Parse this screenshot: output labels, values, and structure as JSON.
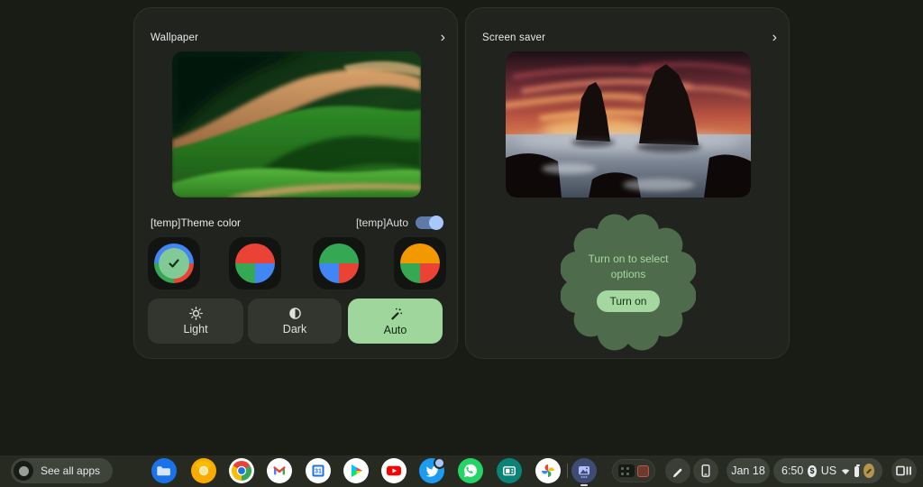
{
  "window": {
    "background": "#191b15",
    "shelf_background": "#262a21"
  },
  "wallpaper_card": {
    "title": "Wallpaper",
    "chevron": "›",
    "theme_color_label": "[temp]Theme color",
    "auto_label": "[temp]Auto",
    "auto_toggle_on": true,
    "toggle_on_color": "#a8c7fa",
    "swatches": [
      {
        "name": "color-scheme-1",
        "top": "#4285f4",
        "bottom_left": "#34a853",
        "bottom_right": "#ea4335",
        "selected": true
      },
      {
        "name": "color-scheme-2",
        "top": "#ea4335",
        "bottom_left": "#34a853",
        "bottom_right": "#4285f4",
        "selected": false
      },
      {
        "name": "color-scheme-3",
        "top": "#34a853",
        "bottom_left": "#4285f4",
        "bottom_right": "#ea4335",
        "selected": false
      },
      {
        "name": "color-scheme-4",
        "top": "#f29900",
        "bottom_left": "#34a853",
        "bottom_right": "#ea4335",
        "selected": false
      }
    ],
    "mode_buttons": [
      {
        "label": "Light",
        "icon": "sun-icon",
        "selected": false
      },
      {
        "label": "Dark",
        "icon": "half-moon-icon",
        "selected": false
      },
      {
        "label": "Auto",
        "icon": "magic-wand-icon",
        "selected": true
      }
    ],
    "selected_button_color": "#9ed69b"
  },
  "screensaver_card": {
    "title": "Screen saver",
    "chevron": "›",
    "blob_message": "Turn on to select options",
    "turn_on_label": "Turn on",
    "blob_color": "#4e6b4b",
    "blob_text_color": "#a6d8a2"
  },
  "shelf": {
    "see_all_apps_label": "See all apps",
    "apps": [
      {
        "name": "files-app-icon"
      },
      {
        "name": "chrome-canary-icon"
      },
      {
        "name": "chrome-icon"
      },
      {
        "name": "gmail-icon"
      },
      {
        "name": "calendar-icon",
        "glyph_text": "31"
      },
      {
        "name": "play-store-icon"
      },
      {
        "name": "youtube-icon"
      },
      {
        "name": "twitter-icon",
        "notification_dot": true
      },
      {
        "name": "whatsapp-icon"
      },
      {
        "name": "tv-app-icon"
      },
      {
        "name": "photos-icon"
      },
      {
        "name": "wallpaper-app-icon",
        "active": true
      },
      {
        "name": "holding-space-tote"
      },
      {
        "name": "stylus-tools-icon"
      },
      {
        "name": "phone-hub-icon"
      }
    ],
    "date": "Jan 18",
    "status": {
      "time": "6:50",
      "badge_glyph": "$",
      "ime": "US"
    }
  }
}
